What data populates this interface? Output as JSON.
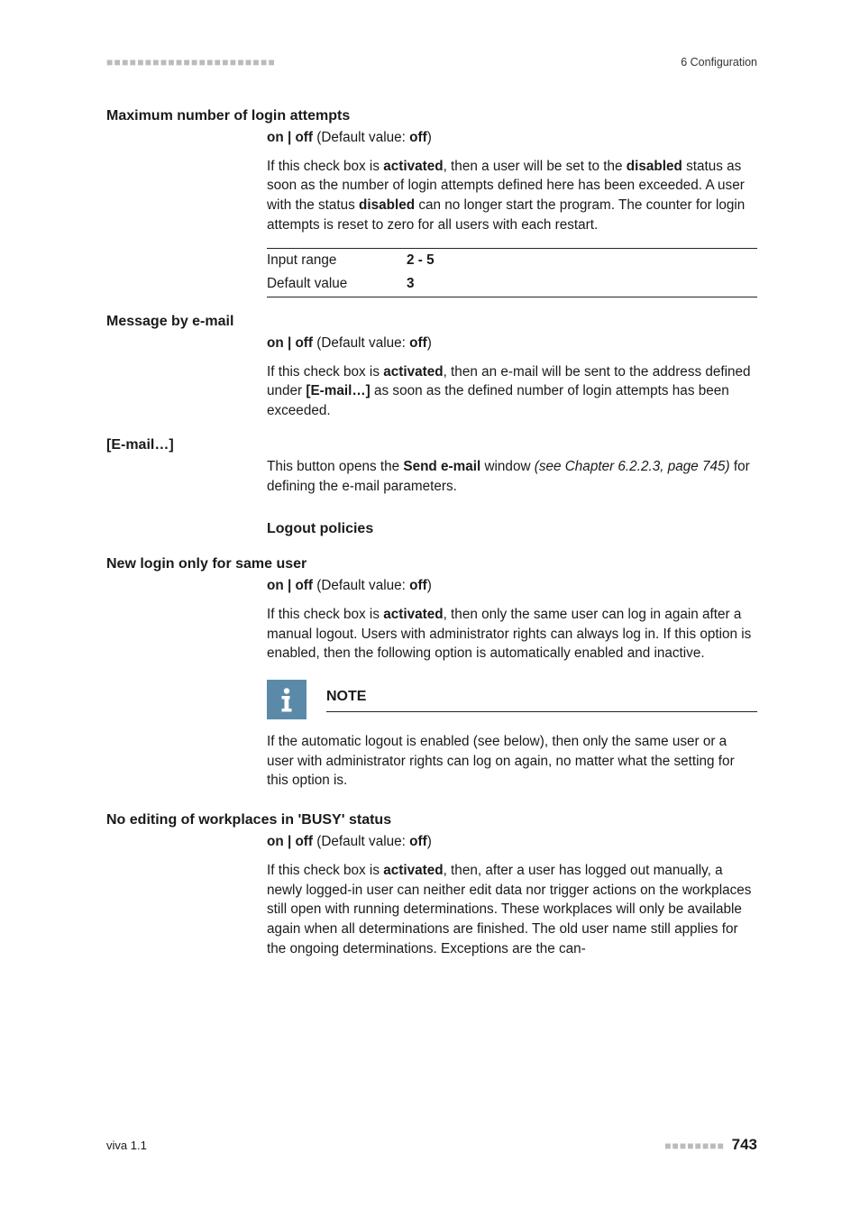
{
  "header": {
    "breadcrumb": "6 Configuration"
  },
  "sections": {
    "maxAttempts": {
      "heading": "Maximum number of login attempts",
      "optLine_pre": "on | off",
      "optLine_mid": " (Default value: ",
      "optLine_val": "off",
      "optLine_post": ")",
      "p1_a": "If this check box is ",
      "p1_b": "activated",
      "p1_c": ", then a user will be set to the ",
      "p1_d": "disabled",
      "p1_e": " status as soon as the number of login attempts defined here has been exceeded. A user with the status ",
      "p1_f": "disabled",
      "p1_g": " can no longer start the program. The counter for login attempts is reset to zero for all users with each restart.",
      "tbl": {
        "r1l": "Input range",
        "r1v": "2 - 5",
        "r2l": "Default value",
        "r2v": "3"
      }
    },
    "msgEmail": {
      "heading": "Message by e-mail",
      "optLine_pre": "on | off",
      "optLine_mid": " (Default value: ",
      "optLine_val": "off",
      "optLine_post": ")",
      "p1_a": "If this check box is ",
      "p1_b": "activated",
      "p1_c": ", then an e-mail will be sent to the address defined under ",
      "p1_d": "[E-mail…]",
      "p1_e": " as soon as the defined number of login attempts has been exceeded."
    },
    "emailBtn": {
      "heading": "[E-mail…]",
      "p1_a": "This button opens the ",
      "p1_b": "Send e-mail",
      "p1_c": " window ",
      "p1_d": "(see Chapter 6.2.2.3, page 745)",
      "p1_e": " for defining the e-mail parameters."
    },
    "logoutPolicies": {
      "heading": "Logout policies"
    },
    "sameUser": {
      "heading": "New login only for same user",
      "optLine_pre": "on | off",
      "optLine_mid": " (Default value: ",
      "optLine_val": "off",
      "optLine_post": ")",
      "p1_a": "If this check box is ",
      "p1_b": "activated",
      "p1_c": ", then only the same user can log in again after a manual logout. Users with administrator rights can always log in. If this option is enabled, then the following option is automatically enabled and inactive.",
      "note_title": "NOTE",
      "note_body": "If the automatic logout is enabled (see below), then only the same user or a user with administrator rights can log on again, no matter what the setting for this option is."
    },
    "busy": {
      "heading": "No editing of workplaces in 'BUSY' status",
      "optLine_pre": "on | off",
      "optLine_mid": " (Default value: ",
      "optLine_val": "off",
      "optLine_post": ")",
      "p1_a": "If this check box is ",
      "p1_b": "activated",
      "p1_c": ", then, after a user has logged out manually, a newly logged-in user can neither edit data nor trigger actions on the workplaces still open with running determinations. These workplaces will only be available again when all determinations are finished. The old user name still applies for the ongoing determinations. Exceptions are the can-"
    }
  },
  "footer": {
    "left": "viva 1.1",
    "page": "743"
  }
}
